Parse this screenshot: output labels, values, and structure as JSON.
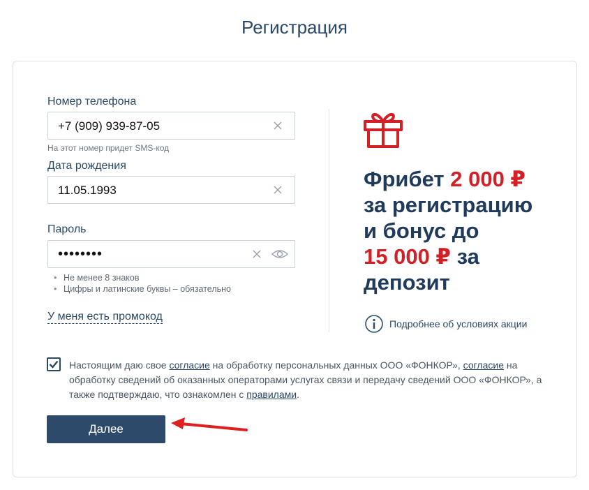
{
  "page": {
    "title": "Регистрация"
  },
  "form": {
    "phone": {
      "label": "Номер телефона",
      "value": "+7 (909) 939-87-05",
      "hint": "На этот номер придет SMS-код"
    },
    "birthdate": {
      "label": "Дата рождения",
      "value": "11.05.1993"
    },
    "password": {
      "label": "Пароль",
      "value": "••••••••",
      "rules": [
        "Не менее 8 знаков",
        "Цифры и латинские буквы – обязательно"
      ]
    },
    "promo_link": "У меня есть промокод"
  },
  "promo": {
    "line1_text": "Фрибет ",
    "line1_amount": "2 000 ₽",
    "line2": "за регистрацию",
    "line3": "и бонус до",
    "line4_amount": "15 000 ₽",
    "line4_text": " за",
    "line5": "депозит",
    "terms_link": "Подробнее об условиях акции"
  },
  "consent": {
    "checked": true,
    "text1": "Настоящим даю свое ",
    "link1": "согласие",
    "text2": " на обработку персональных данных ООО «ФОНКОР», ",
    "link2": "согласие",
    "text3": " на обработку сведений об оказанных операторами услугах связи и передачу сведений ООО «ФОНКОР», а также подтверждаю, что ознакомлен с ",
    "link3": "правилами",
    "text4": "."
  },
  "actions": {
    "next_label": "Далее"
  },
  "colors": {
    "accent": "#2d4a6a",
    "promo_red": "#d32027",
    "annotation_arrow": "#e02020"
  },
  "icons": [
    "clear-icon",
    "eye-icon",
    "gift-icon",
    "info-icon",
    "checkmark-icon"
  ]
}
